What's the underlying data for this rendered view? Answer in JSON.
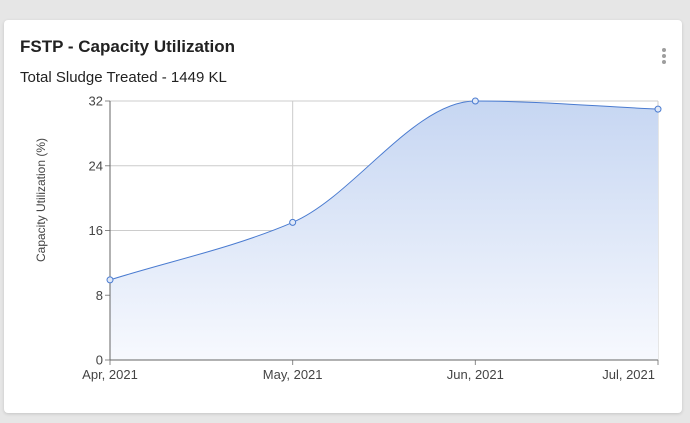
{
  "card": {
    "title": "FSTP - Capacity Utilization",
    "subtitle": "Total Sludge Treated - 1449 KL",
    "menu_icon": "more-vert-icon"
  },
  "colors": {
    "line": "#4a7bd0",
    "fill_top": "#c6d6f2",
    "fill_bottom": "#f7f9fe",
    "grid": "#cccccc",
    "axis_text": "#444444"
  },
  "chart_data": {
    "type": "area",
    "title": "",
    "xlabel": "",
    "ylabel": "Capacity Utilization (%)",
    "categories": [
      "Apr, 2021",
      "May, 2021",
      "Jun, 2021",
      "Jul, 2021"
    ],
    "values": [
      9.9,
      17.0,
      32.0,
      31.0
    ],
    "ylim": [
      0,
      32
    ],
    "yticks": [
      0,
      8,
      16,
      24,
      32
    ],
    "grid": true,
    "smooth": true,
    "markers": true
  }
}
